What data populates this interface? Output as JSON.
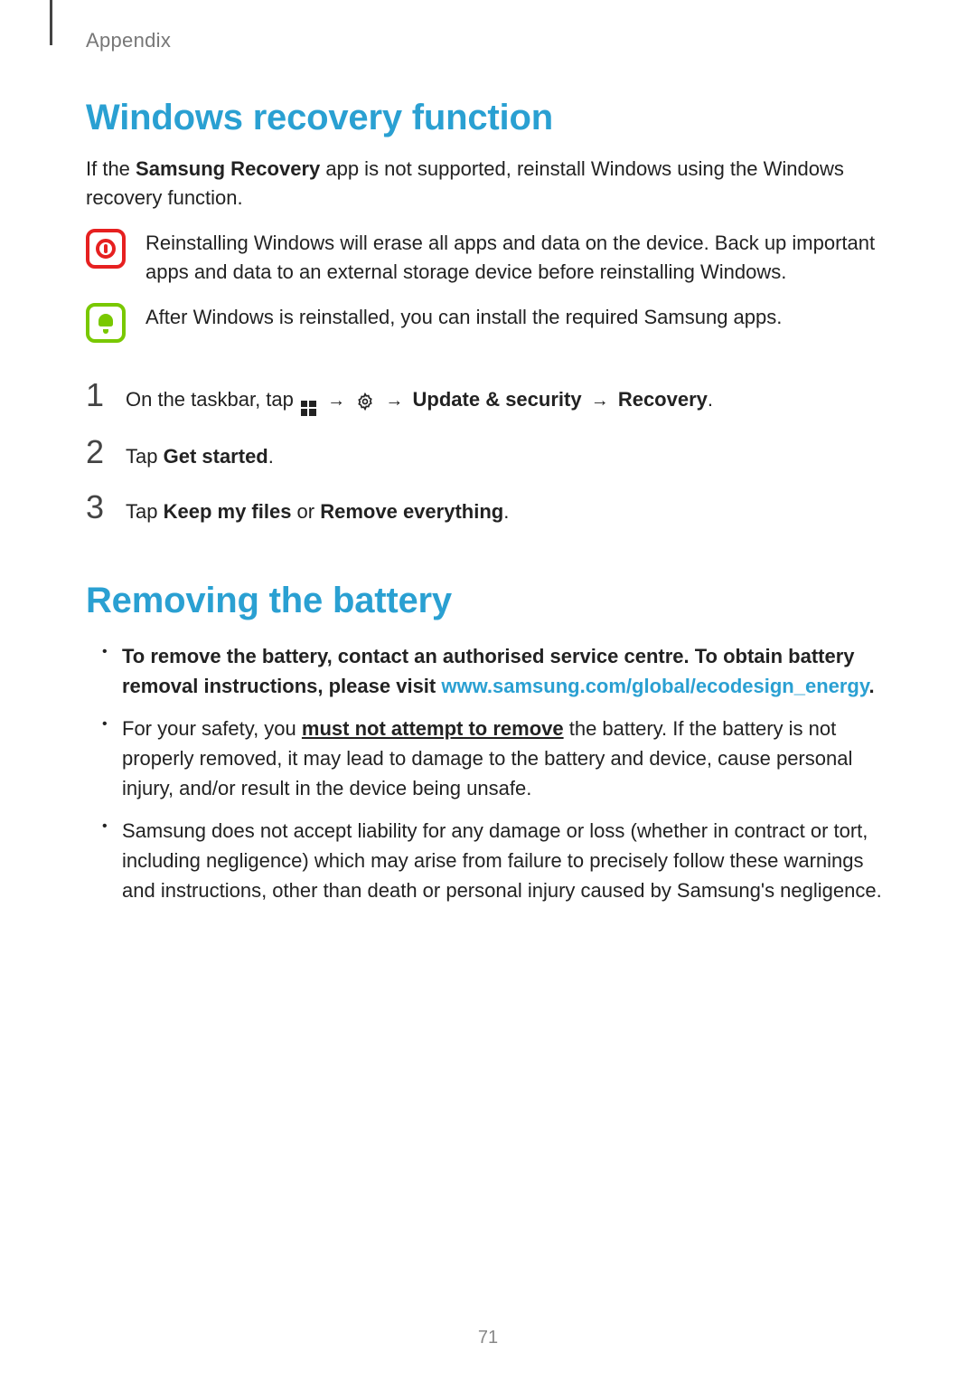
{
  "header": {
    "section_label": "Appendix"
  },
  "section1": {
    "title": "Windows recovery function",
    "intro_pre": "If the ",
    "intro_bold": "Samsung Recovery",
    "intro_post": " app is not supported, reinstall Windows using the Windows recovery function.",
    "warning_text": "Reinstalling Windows will erase all apps and data on the device. Back up important apps and data to an external storage device before reinstalling Windows.",
    "note_text": "After Windows is reinstalled, you can install the required Samsung apps.",
    "steps": {
      "s1": {
        "num": "1",
        "pre": "On the taskbar, tap ",
        "arrow1": "→",
        "arrow2": "→",
        "bold1": "Update & security",
        "arrow3": "→",
        "bold2": "Recovery",
        "end": "."
      },
      "s2": {
        "num": "2",
        "pre": "Tap ",
        "bold": "Get started",
        "end": "."
      },
      "s3": {
        "num": "3",
        "pre": "Tap ",
        "bold1": "Keep my files",
        "mid": " or ",
        "bold2": "Remove everything",
        "end": "."
      }
    }
  },
  "section2": {
    "title": "Removing the battery",
    "b1_pre": "To remove the battery, contact an authorised service centre. To obtain battery removal instructions, please visit ",
    "b1_link": "www.samsung.com/global/ecodesign_energy",
    "b1_end": ".",
    "b2_pre": "For your safety, you ",
    "b2_underline": "must not attempt to remove",
    "b2_post": " the battery. If the battery is not properly removed, it may lead to damage to the battery and device, cause personal injury, and/or result in the device being unsafe.",
    "b3": "Samsung does not accept liability for any damage or loss (whether in contract or tort, including negligence) which may arise from failure to precisely follow these warnings and instructions, other than death or personal injury caused by Samsung's negligence."
  },
  "page_number": "71"
}
